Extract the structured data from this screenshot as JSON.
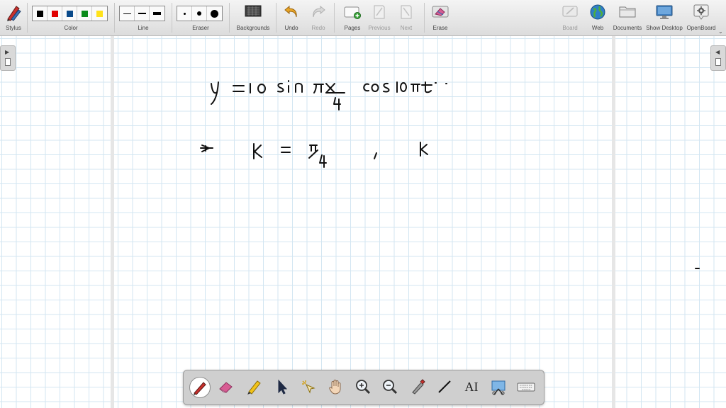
{
  "toolbar": {
    "stylus": "Stylus",
    "color": "Color",
    "line": "Line",
    "eraser": "Eraser",
    "backgrounds": "Backgrounds",
    "undo": "Undo",
    "redo": "Redo",
    "pages": "Pages",
    "previous": "Previous",
    "next": "Next",
    "erase": "Erase",
    "board": "Board",
    "web": "Web",
    "documents": "Documents",
    "show_desktop": "Show Desktop",
    "openboard": "OpenBoard"
  },
  "colors": {
    "swatches": [
      "#000000",
      "#e00000",
      "#0a4a8a",
      "#0a8a1a",
      "#ffe21a"
    ],
    "grid": "#d3e6f2",
    "ink": "#111111"
  },
  "icons": {
    "dock": [
      "pen-icon",
      "eraser-icon",
      "highlighter-icon",
      "pointer-icon",
      "laser-icon",
      "hand-icon",
      "zoom-in-icon",
      "zoom-out-icon",
      "capture-icon",
      "line-icon",
      "text-icon",
      "screenshot-icon",
      "keyboard-icon"
    ]
  },
  "dock": {
    "text_tool": "AI"
  }
}
